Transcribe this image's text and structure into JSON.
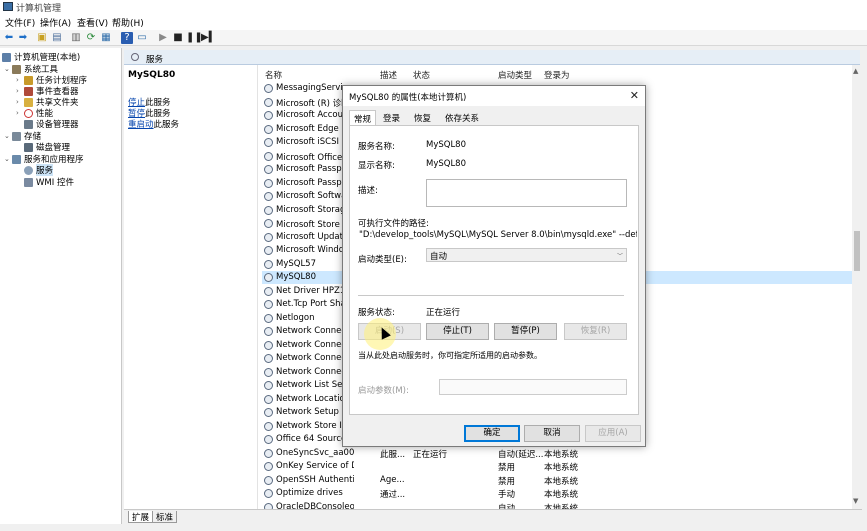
{
  "window": {
    "title": "计算机管理"
  },
  "menu": [
    "文件(F)",
    "操作(A)",
    "查看(V)",
    "帮助(H)"
  ],
  "tree": {
    "root": "计算机管理(本地)",
    "system_tools": "系统工具",
    "task_scheduler": "任务计划程序",
    "event_viewer": "事件查看器",
    "shared_folders": "共享文件夹",
    "performance": "性能",
    "device_manager": "设备管理器",
    "storage": "存储",
    "disk_management": "磁盘管理",
    "services_apps": "服务和应用程序",
    "services": "服务",
    "wmi": "WMI 控件"
  },
  "pane_header": "服务",
  "detail": {
    "service_name": "MySQL80",
    "link_stop": "停止",
    "link_stop_suffix": "此服务",
    "link_pause": "暂停",
    "link_pause_suffix": "此服务",
    "link_restart": "重启动",
    "link_restart_suffix": "此服务"
  },
  "columns": {
    "name": "名称",
    "desc": "描述",
    "status": "状态",
    "startup": "启动类型",
    "logon": "登录为"
  },
  "services": [
    {
      "name": "MessagingService...",
      "desc": "",
      "status": "",
      "startup": "",
      "logon": ""
    },
    {
      "name": "Microsoft (R) 诊断中心...",
      "desc": "",
      "status": "",
      "startup": "",
      "logon": ""
    },
    {
      "name": "Microsoft Account ...",
      "desc": "",
      "status": "",
      "startup": "",
      "logon": ""
    },
    {
      "name": "Microsoft Edge Elev...",
      "desc": "",
      "status": "",
      "startup": "",
      "logon": ""
    },
    {
      "name": "Microsoft iSCSI Init...",
      "desc": "",
      "status": "",
      "startup": "",
      "logon": ""
    },
    {
      "name": "Microsoft Office 即...",
      "desc": "",
      "status": "",
      "startup": "",
      "logon": ""
    },
    {
      "name": "Microsoft Passport ...",
      "desc": "",
      "status": "",
      "startup": "",
      "logon": ""
    },
    {
      "name": "Microsoft Passport ...",
      "desc": "",
      "status": "",
      "startup": "",
      "logon": ""
    },
    {
      "name": "Microsoft Software ...",
      "desc": "",
      "status": "",
      "startup": "",
      "logon": ""
    },
    {
      "name": "Microsoft Storage S...",
      "desc": "",
      "status": "",
      "startup": "",
      "logon": ""
    },
    {
      "name": "Microsoft Store 安装...",
      "desc": "",
      "status": "",
      "startup": "",
      "logon": ""
    },
    {
      "name": "Microsoft Update H...",
      "desc": "",
      "status": "",
      "startup": "",
      "logon": ""
    },
    {
      "name": "Microsoft Windows ...",
      "desc": "",
      "status": "",
      "startup": "",
      "logon": ""
    },
    {
      "name": "MySQL57",
      "desc": "",
      "status": "",
      "startup": "",
      "logon": ""
    },
    {
      "name": "MySQL80",
      "desc": "",
      "status": "",
      "startup": "",
      "logon": ""
    },
    {
      "name": "Net Driver HPZ12",
      "desc": "",
      "status": "",
      "startup": "",
      "logon": ""
    },
    {
      "name": "Net.Tcp Port Sharin...",
      "desc": "",
      "status": "",
      "startup": "",
      "logon": ""
    },
    {
      "name": "Netlogon",
      "desc": "",
      "status": "",
      "startup": "",
      "logon": ""
    },
    {
      "name": "Network Connecte...",
      "desc": "",
      "status": "",
      "startup": "",
      "logon": ""
    },
    {
      "name": "Network Connectio...",
      "desc": "",
      "status": "",
      "startup": "",
      "logon": ""
    },
    {
      "name": "Network Connectio...",
      "desc": "",
      "status": "",
      "startup": "",
      "logon": ""
    },
    {
      "name": "Network Connectivi...",
      "desc": "",
      "status": "",
      "startup": "",
      "logon": ""
    },
    {
      "name": "Network List Service",
      "desc": "",
      "status": "",
      "startup": "",
      "logon": ""
    },
    {
      "name": "Network Location A...",
      "desc": "",
      "status": "",
      "startup": "",
      "logon": ""
    },
    {
      "name": "Network Setup Ser...",
      "desc": "",
      "status": "",
      "startup": "",
      "logon": ""
    },
    {
      "name": "Network Store Inte...",
      "desc": "",
      "status": "",
      "startup": "",
      "logon": ""
    },
    {
      "name": "Office 64 Source En...",
      "desc": "",
      "status": "",
      "startup": "",
      "logon": ""
    },
    {
      "name": "OneSyncSvc_aa008",
      "desc": "此服...",
      "status": "正在运行",
      "startup": "自动(延迟...",
      "logon": "本地系统"
    },
    {
      "name": "OnKey Service of DB USB ...",
      "desc": "",
      "status": "",
      "startup": "禁用",
      "logon": "本地系统"
    },
    {
      "name": "OpenSSH Authentication ...",
      "desc": "Age...",
      "status": "",
      "startup": "禁用",
      "logon": "本地系统"
    },
    {
      "name": "Optimize drives",
      "desc": "通过...",
      "status": "",
      "startup": "手动",
      "logon": "本地系统"
    },
    {
      "name": "OracleDBConsoleorcl",
      "desc": "",
      "status": "",
      "startup": "自动",
      "logon": "本地系统"
    }
  ],
  "bottom_tabs": [
    "扩展",
    "标准"
  ],
  "dialog": {
    "title": "MySQL80 的属性(本地计算机)",
    "tabs": [
      "常规",
      "登录",
      "恢复",
      "依存关系"
    ],
    "service_name_label": "服务名称:",
    "service_name_value": "MySQL80",
    "display_name_label": "显示名称:",
    "display_name_value": "MySQL80",
    "description_label": "描述:",
    "exe_path_label": "可执行文件的路径:",
    "exe_path_value": "\"D:\\develop_tools\\MySQL\\MySQL Server 8.0\\bin\\mysqld.exe\" --defaults-file",
    "startup_type_label": "启动类型(E):",
    "startup_type_value": "自动",
    "status_label": "服务状态:",
    "status_value": "正在运行",
    "btn_start": "启动(S)",
    "btn_stop": "停止(T)",
    "btn_pause": "暂停(P)",
    "btn_resume": "恢复(R)",
    "hint": "当从此处启动服务时，你可指定所适用的启动参数。",
    "start_params_label": "启动参数(M):",
    "ok": "确定",
    "cancel": "取消",
    "apply": "应用(A)"
  }
}
